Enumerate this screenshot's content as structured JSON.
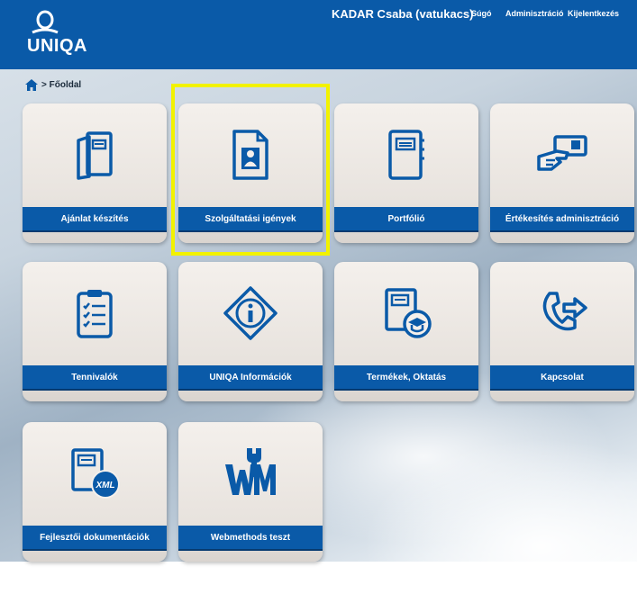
{
  "header": {
    "logo_text": "UNIQA",
    "user": "KADAR Csaba (vatukacs)",
    "links": [
      "Súgó",
      "Adminisztráció",
      "Kijelentkezés"
    ],
    "brand_color": "#0a5aa8"
  },
  "breadcrumb": {
    "current": "> Főoldal"
  },
  "tiles": [
    {
      "label": "Ajánlat készítés",
      "icon": "document-icon"
    },
    {
      "label": "Szolgáltatási igények",
      "icon": "person-document-icon"
    },
    {
      "label": "Portfólió",
      "icon": "notebook-icon"
    },
    {
      "label": "Értékesítés adminisztráció",
      "icon": "hand-card-icon"
    },
    {
      "label": "Tennivalók",
      "icon": "checklist-clipboard-icon"
    },
    {
      "label": "UNIQA Információk",
      "icon": "info-sign-icon"
    },
    {
      "label": "Termékek, Oktatás",
      "icon": "education-document-icon"
    },
    {
      "label": "Kapcsolat",
      "icon": "phone-arrow-icon"
    },
    {
      "label": "Fejlesztői dokumentációk",
      "icon": "xml-document-icon"
    },
    {
      "label": "Webmethods teszt",
      "icon": "wm-wrench-icon"
    }
  ],
  "highlight_color": "#f2f200"
}
